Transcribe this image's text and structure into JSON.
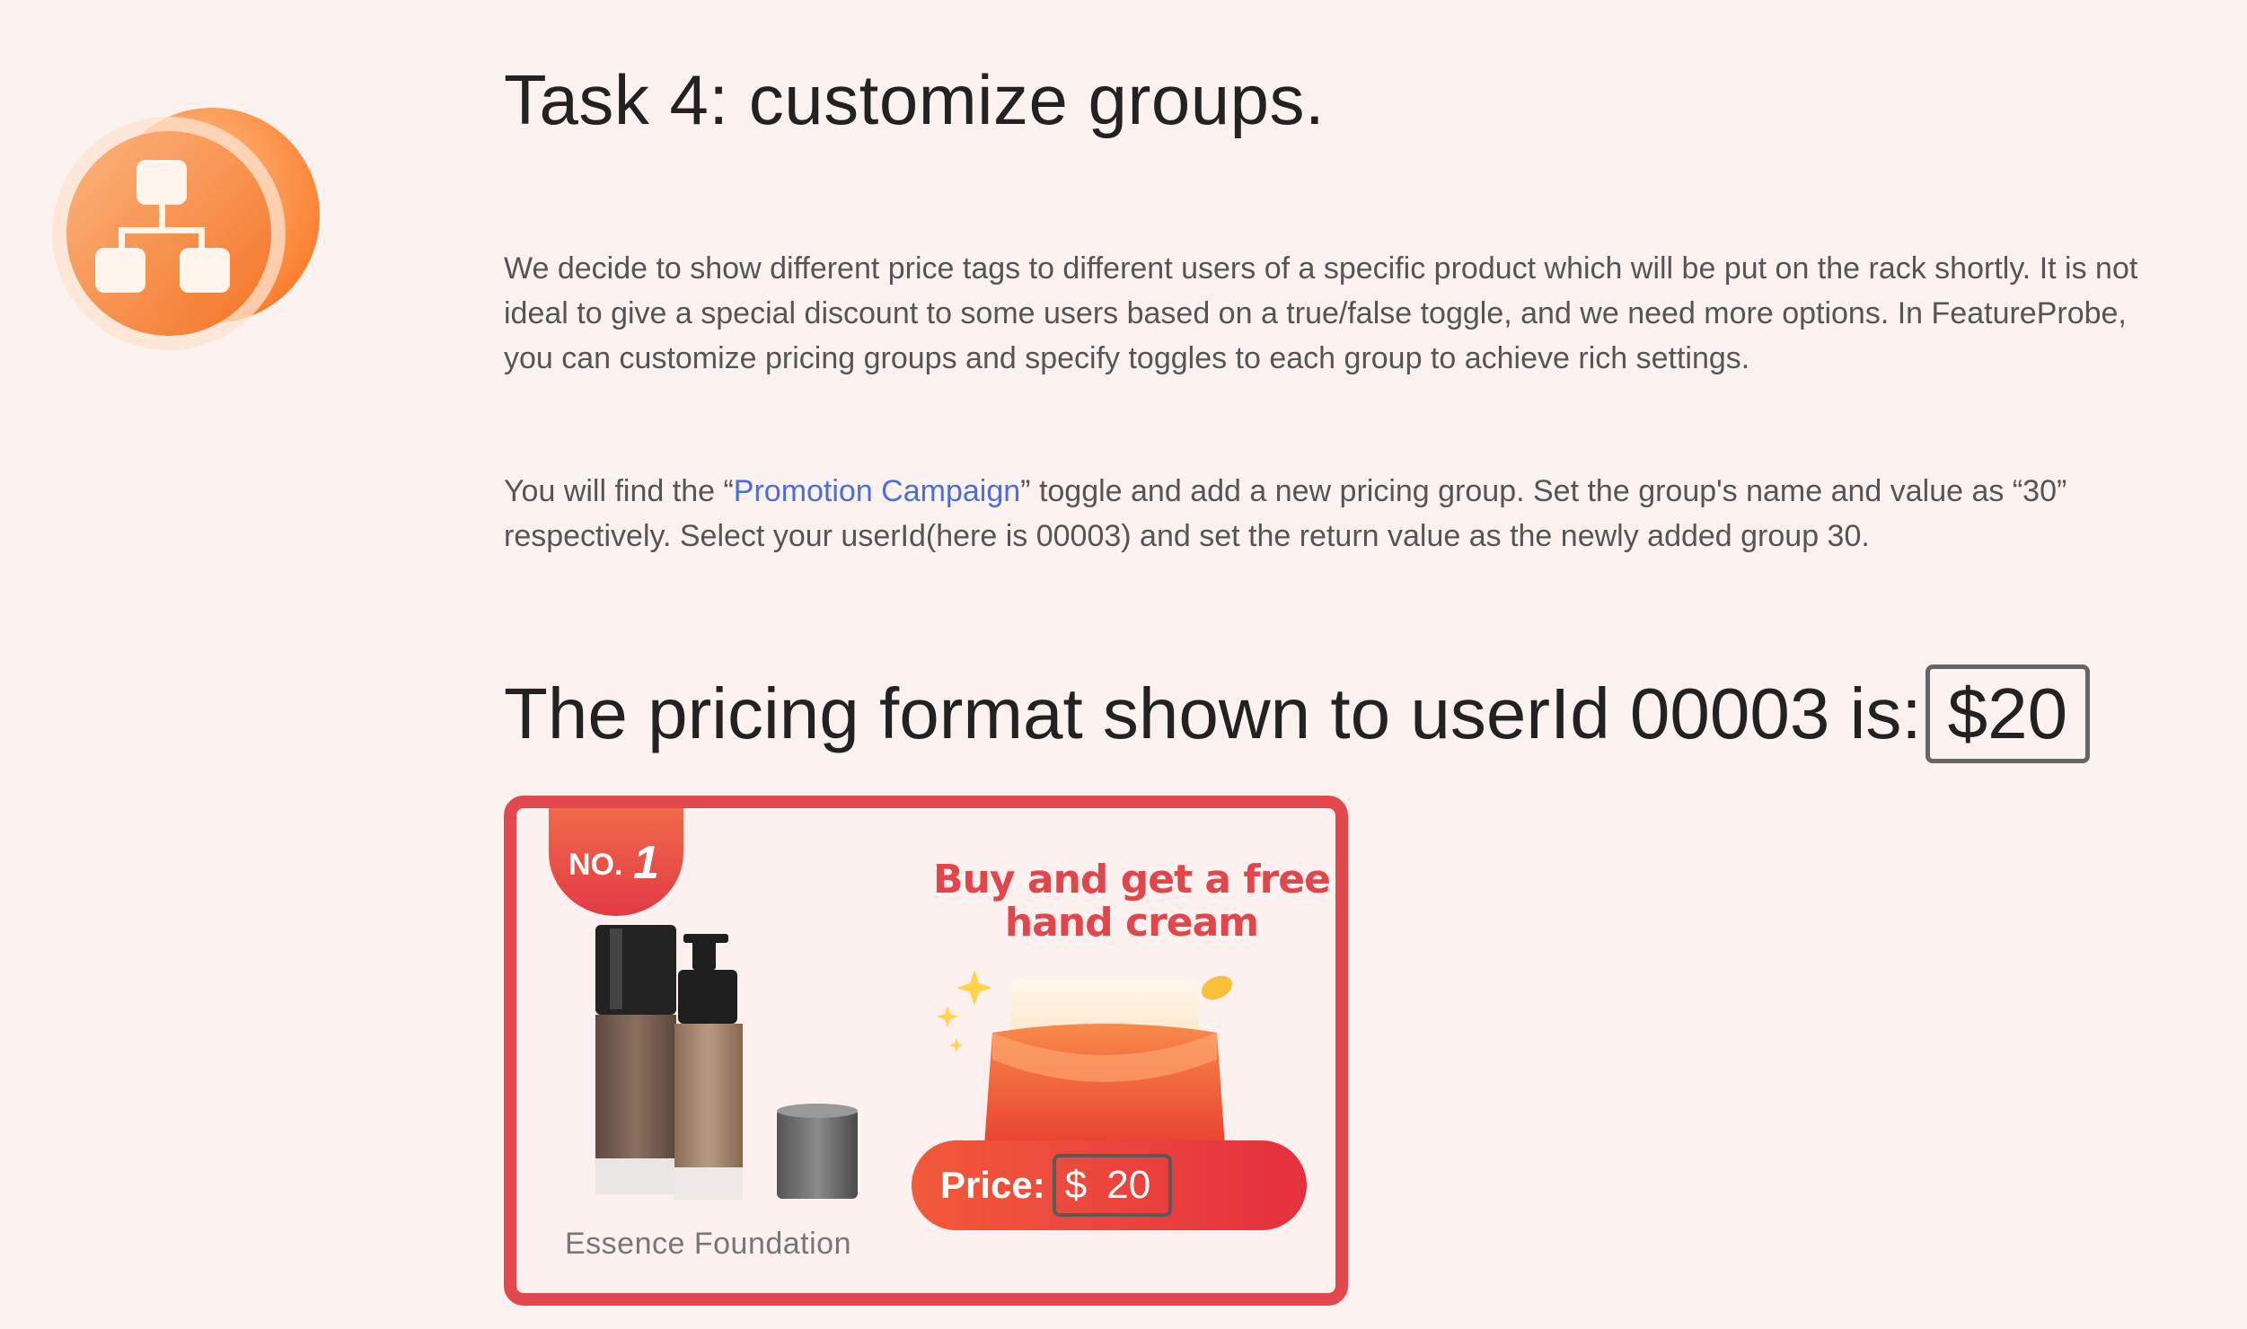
{
  "task": {
    "title": "Task 4: customize groups.",
    "para1": "We decide to show different price tags to different users of a specific product which will be put on the rack shortly. It is not ideal to give a special discount to some users based on a true/false toggle, and we need more options. In FeatureProbe, you can customize pricing groups and specify toggles to each group to achieve rich settings.",
    "para2_before": "You will find the “",
    "para2_link": "Promotion Campaign",
    "para2_after": "” toggle and add a new pricing group. Set the group's name and value as “30” respectively. Select your userId(here is 00003) and set the return value as the newly added group 30."
  },
  "pricing": {
    "label": "The pricing format shown to userId 00003 is:",
    "value": "$20"
  },
  "card": {
    "rank_prefix": "NO.",
    "rank_number": "1",
    "product_name": "Essence Foundation",
    "promo_line1": "Buy and get a free",
    "promo_line2": "hand cream",
    "price_label": "Price:",
    "currency": "$",
    "price": "20"
  },
  "colors": {
    "background": "#fcf3f1",
    "accent_orange": "#fb8a3a",
    "card_border": "#e4484f",
    "link": "#4a6ee0"
  }
}
